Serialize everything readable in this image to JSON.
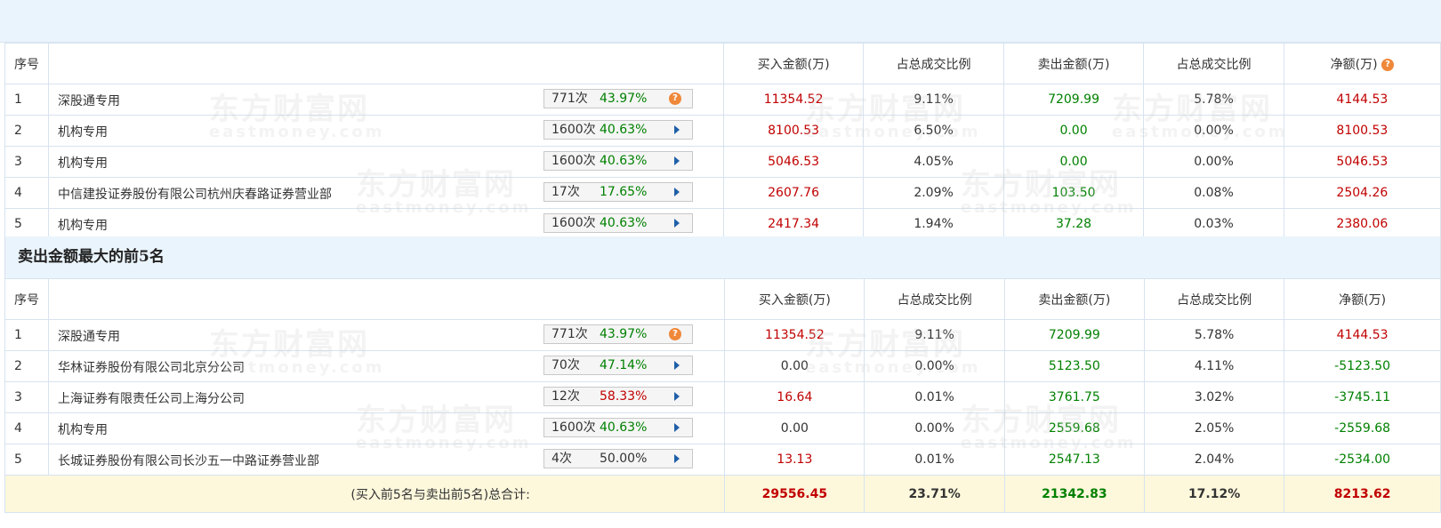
{
  "headers": {
    "idx": "序号",
    "buy_amount": "买入金额(万)",
    "buy_ratio": "占总成交比例",
    "sell_amount": "卖出金额(万)",
    "sell_ratio": "占总成交比例",
    "net": "净额(万)"
  },
  "section2_title": "卖出金额最大的前5名",
  "watermark": {
    "cn": "东方财富网",
    "en": "eastmoney.com"
  },
  "buy_rows": [
    {
      "idx": "1",
      "name": "深股通专用",
      "count": "771次",
      "pct": "43.97%",
      "pct_color": "green",
      "icon": "help-icon",
      "buy": "11354.52",
      "buy_ratio": "9.11%",
      "sell": "7209.99",
      "sell_ratio": "5.78%",
      "net": "4144.53",
      "net_color": "red"
    },
    {
      "idx": "2",
      "name": "机构专用",
      "count": "1600次",
      "pct": "40.63%",
      "pct_color": "green",
      "icon": "arrow-icon",
      "buy": "8100.53",
      "buy_ratio": "6.50%",
      "sell": "0.00",
      "sell_ratio": "0.00%",
      "net": "8100.53",
      "net_color": "red"
    },
    {
      "idx": "3",
      "name": "机构专用",
      "count": "1600次",
      "pct": "40.63%",
      "pct_color": "green",
      "icon": "arrow-icon",
      "buy": "5046.53",
      "buy_ratio": "4.05%",
      "sell": "0.00",
      "sell_ratio": "0.00%",
      "net": "5046.53",
      "net_color": "red"
    },
    {
      "idx": "4",
      "name": "中信建投证券股份有限公司杭州庆春路证券营业部",
      "count": "17次",
      "pct": "17.65%",
      "pct_color": "green",
      "icon": "arrow-icon",
      "buy": "2607.76",
      "buy_ratio": "2.09%",
      "sell": "103.50",
      "sell_ratio": "0.08%",
      "net": "2504.26",
      "net_color": "red"
    },
    {
      "idx": "5",
      "name": "机构专用",
      "count": "1600次",
      "pct": "40.63%",
      "pct_color": "green",
      "icon": "arrow-icon",
      "buy": "2417.34",
      "buy_ratio": "1.94%",
      "sell": "37.28",
      "sell_ratio": "0.03%",
      "net": "2380.06",
      "net_color": "red"
    }
  ],
  "sell_rows": [
    {
      "idx": "1",
      "name": "深股通专用",
      "count": "771次",
      "pct": "43.97%",
      "pct_color": "green",
      "icon": "help-icon",
      "buy": "11354.52",
      "buy_color": "red",
      "buy_ratio": "9.11%",
      "sell": "7209.99",
      "sell_ratio": "5.78%",
      "net": "4144.53",
      "net_color": "red"
    },
    {
      "idx": "2",
      "name": "华林证券股份有限公司北京分公司",
      "count": "70次",
      "pct": "47.14%",
      "pct_color": "green",
      "icon": "arrow-icon",
      "buy": "0.00",
      "buy_color": "dark",
      "buy_ratio": "0.00%",
      "sell": "5123.50",
      "sell_ratio": "4.11%",
      "net": "-5123.50",
      "net_color": "green"
    },
    {
      "idx": "3",
      "name": "上海证券有限责任公司上海分公司",
      "count": "12次",
      "pct": "58.33%",
      "pct_color": "red",
      "icon": "arrow-icon",
      "buy": "16.64",
      "buy_color": "red",
      "buy_ratio": "0.01%",
      "sell": "3761.75",
      "sell_ratio": "3.02%",
      "net": "-3745.11",
      "net_color": "green"
    },
    {
      "idx": "4",
      "name": "机构专用",
      "count": "1600次",
      "pct": "40.63%",
      "pct_color": "green",
      "icon": "arrow-icon",
      "buy": "0.00",
      "buy_color": "dark",
      "buy_ratio": "0.00%",
      "sell": "2559.68",
      "sell_ratio": "2.05%",
      "net": "-2559.68",
      "net_color": "green"
    },
    {
      "idx": "5",
      "name": "长城证券股份有限公司长沙五一中路证券营业部",
      "count": "4次",
      "pct": "50.00%",
      "pct_color": "dark",
      "icon": "arrow-icon",
      "buy": "13.13",
      "buy_color": "red",
      "buy_ratio": "0.01%",
      "sell": "2547.13",
      "sell_ratio": "2.04%",
      "net": "-2534.00",
      "net_color": "green"
    }
  ],
  "total": {
    "label": "(买入前5名与卖出前5名)总合计:",
    "buy": "29556.45",
    "buy_ratio": "23.71%",
    "sell": "21342.83",
    "sell_ratio": "17.12%",
    "net": "8213.62"
  },
  "colors": {
    "up": "#c10000",
    "down": "#008000",
    "accent": "#eaf4fc"
  }
}
